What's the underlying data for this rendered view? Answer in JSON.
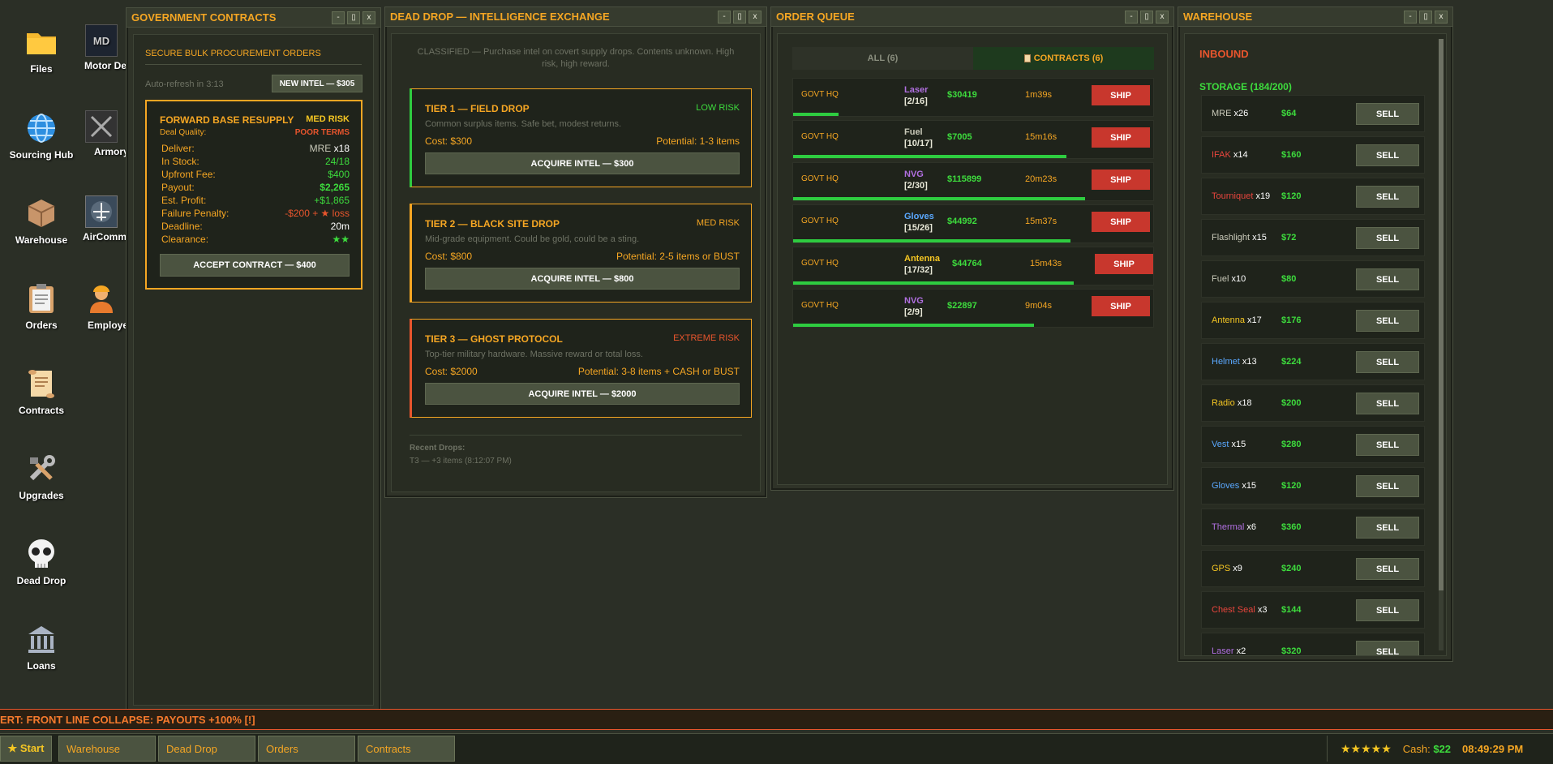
{
  "desktop": {
    "icons": [
      {
        "label": "Files",
        "icon": "folder-icon"
      },
      {
        "label": "Sourcing Hub",
        "icon": "globe-icon"
      },
      {
        "label": "Warehouse",
        "icon": "box-icon"
      },
      {
        "label": "Orders",
        "icon": "clipboard-icon"
      },
      {
        "label": "Contracts",
        "icon": "scroll-icon"
      },
      {
        "label": "Upgrades",
        "icon": "tools-icon"
      },
      {
        "label": "Dead Drop",
        "icon": "skull-icon"
      },
      {
        "label": "Loans",
        "icon": "bank-icon"
      }
    ],
    "icons2": [
      {
        "label": "Motor De",
        "icon": "motor-depot-icon"
      },
      {
        "label": "Armory",
        "icon": "rifle-icon"
      },
      {
        "label": "AirComm",
        "icon": "aircraft-icon"
      },
      {
        "label": "Employe",
        "icon": "worker-icon"
      }
    ]
  },
  "gov": {
    "title": "GOVERNMENT CONTRACTS",
    "subtitle": "SECURE BULK PROCUREMENT ORDERS",
    "refresh": "Auto-refresh in 3:13",
    "new_intel": "NEW INTEL — $305",
    "card": {
      "name": "FORWARD BASE RESUPPLY",
      "risk": "MED RISK",
      "quality_label": "Deal Quality:",
      "quality": "POOR TERMS",
      "rows": [
        {
          "k": "Deliver:",
          "v": "MRE",
          "v2": "x18"
        },
        {
          "k": "In Stock:",
          "v": "24/18"
        },
        {
          "k": "Upfront Fee:",
          "v": "$400"
        },
        {
          "k": "Payout:",
          "v": "$2,265"
        },
        {
          "k": "Est. Profit:",
          "v": "+$1,865"
        },
        {
          "k": "Failure Penalty:",
          "v": "-$200 + ★ loss"
        },
        {
          "k": "Deadline:",
          "v": "20m"
        },
        {
          "k": "Clearance:",
          "v": "★★"
        }
      ],
      "accept": "ACCEPT CONTRACT — $400"
    }
  },
  "dead": {
    "title": "DEAD DROP — INTELLIGENCE EXCHANGE",
    "banner": "CLASSIFIED — Purchase intel on covert supply drops. Contents unknown. High risk, high reward.",
    "tiers": [
      {
        "name": "TIER 1 — FIELD DROP",
        "risk": "LOW RISK",
        "risk_color": "#3ddc3d",
        "border": "#2ecc40",
        "desc": "Common surplus items. Safe bet, modest returns.",
        "cost": "Cost: $300",
        "potential": "Potential: 1-3 items",
        "button": "ACQUIRE INTEL — $300"
      },
      {
        "name": "TIER 2 — BLACK SITE DROP",
        "risk": "MED RISK",
        "risk_color": "#f5a623",
        "border": "#f5a623",
        "desc": "Mid-grade equipment. Could be gold, could be a sting.",
        "cost": "Cost: $800",
        "potential": "Potential: 2-5 items or BUST",
        "button": "ACQUIRE INTEL — $800"
      },
      {
        "name": "TIER 3 — GHOST PROTOCOL",
        "risk": "EXTREME RISK",
        "risk_color": "#e8552d",
        "border": "#e8552d",
        "desc": "Top-tier military hardware. Massive reward or total loss.",
        "cost": "Cost: $2000",
        "potential": "Potential: 3-8 items + CASH or BUST",
        "button": "ACQUIRE INTEL — $2000"
      }
    ],
    "recent_label": "Recent Drops:",
    "recent": "T3 — +3 items (8:12:07 PM)"
  },
  "orders": {
    "title": "ORDER QUEUE",
    "tab_all": "ALL (6)",
    "tab_contracts": "CONTRACTS (6)",
    "rows": [
      {
        "hq": "GOVT HQ",
        "item": "Laser",
        "color": "#b06fe0",
        "qty": "[2/16]",
        "price": "$30419",
        "time": "1m39s",
        "ship": "SHIP",
        "progress": 0.125
      },
      {
        "hq": "GOVT HQ",
        "item": "Fuel",
        "color": "#c8c8b8",
        "qty": "[10/17]",
        "price": "$7005",
        "time": "15m16s",
        "ship": "SHIP",
        "progress": 0.76
      },
      {
        "hq": "GOVT HQ",
        "item": "NVG",
        "color": "#b06fe0",
        "qty": "[2/30]",
        "price": "$115899",
        "time": "20m23s",
        "ship": "SHIP",
        "progress": 0.81
      },
      {
        "hq": "GOVT HQ",
        "item": "Gloves",
        "color": "#5aa8ff",
        "qty": "[15/26]",
        "price": "$44992",
        "time": "15m37s",
        "ship": "SHIP",
        "progress": 0.77
      },
      {
        "hq": "GOVT HQ",
        "item": "Antenna",
        "color": "#f5c623",
        "qty": "[17/32]",
        "price": "$44764",
        "time": "15m43s",
        "ship": "SHIP",
        "progress": 0.78
      },
      {
        "hq": "GOVT HQ",
        "item": "NVG",
        "color": "#b06fe0",
        "qty": "[2/9]",
        "price": "$22897",
        "time": "9m04s",
        "ship": "SHIP",
        "progress": 0.67
      }
    ]
  },
  "warehouse": {
    "title": "WAREHOUSE",
    "inbound": "INBOUND",
    "storage": "STORAGE (184/200)",
    "sell": "SELL",
    "rows": [
      {
        "name": "MRE",
        "color": "#c8c8b8",
        "qty": "x26",
        "price": "$64"
      },
      {
        "name": "IFAK",
        "color": "#e8453d",
        "qty": "x14",
        "price": "$160"
      },
      {
        "name": "Tourniquet",
        "color": "#e8453d",
        "qty": "x19",
        "price": "$120"
      },
      {
        "name": "Flashlight",
        "color": "#c8c8b8",
        "qty": "x15",
        "price": "$72"
      },
      {
        "name": "Fuel",
        "color": "#c8c8b8",
        "qty": "x10",
        "price": "$80"
      },
      {
        "name": "Antenna",
        "color": "#f5c623",
        "qty": "x17",
        "price": "$176"
      },
      {
        "name": "Helmet",
        "color": "#5aa8ff",
        "qty": "x13",
        "price": "$224"
      },
      {
        "name": "Radio",
        "color": "#f5c623",
        "qty": "x18",
        "price": "$200"
      },
      {
        "name": "Vest",
        "color": "#5aa8ff",
        "qty": "x15",
        "price": "$280"
      },
      {
        "name": "Gloves",
        "color": "#5aa8ff",
        "qty": "x15",
        "price": "$120"
      },
      {
        "name": "Thermal",
        "color": "#b06fe0",
        "qty": "x6",
        "price": "$360"
      },
      {
        "name": "GPS",
        "color": "#f5c623",
        "qty": "x9",
        "price": "$240"
      },
      {
        "name": "Chest Seal",
        "color": "#e8453d",
        "qty": "x3",
        "price": "$144"
      },
      {
        "name": "Laser",
        "color": "#b06fe0",
        "qty": "x2",
        "price": "$320"
      }
    ]
  },
  "ticker": "ERT: FRONT LINE COLLAPSE: PAYOUTS +100% [!]",
  "taskbar": {
    "start": "★ Start",
    "tasks": [
      "Warehouse",
      "Dead Drop",
      "Orders",
      "Contracts"
    ],
    "stars": "★★★★★",
    "cash_label": "Cash: ",
    "cash": "$22",
    "clock": "08:49:29 PM"
  },
  "window_controls": {
    "min": "-",
    "max": "▯",
    "close": "x"
  }
}
